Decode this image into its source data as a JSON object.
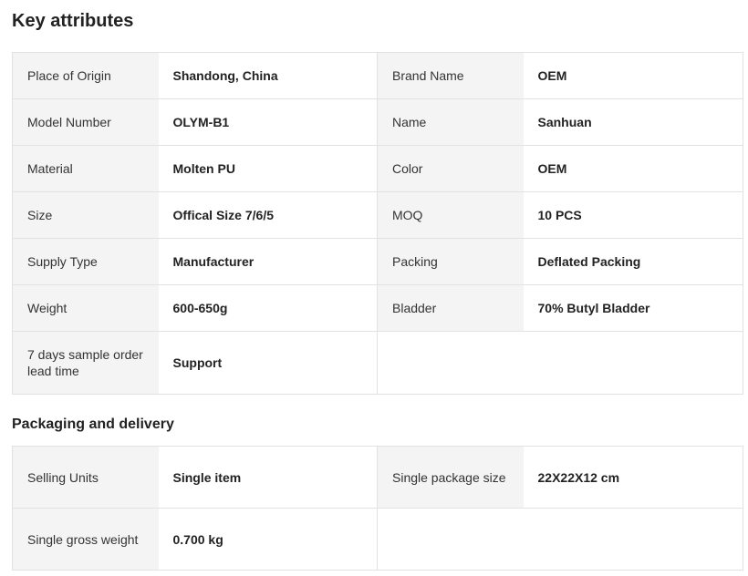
{
  "key_attributes": {
    "title": "Key attributes",
    "rows": [
      {
        "k1": "Place of Origin",
        "v1": "Shandong, China",
        "k2": "Brand Name",
        "v2": "OEM"
      },
      {
        "k1": "Model Number",
        "v1": "OLYM-B1",
        "k2": "Name",
        "v2": "Sanhuan"
      },
      {
        "k1": "Material",
        "v1": "Molten PU",
        "k2": "Color",
        "v2": "OEM"
      },
      {
        "k1": "Size",
        "v1": "Offical Size 7/6/5",
        "k2": "MOQ",
        "v2": "10 PCS"
      },
      {
        "k1": "Supply Type",
        "v1": "Manufacturer",
        "k2": "Packing",
        "v2": "Deflated Packing"
      },
      {
        "k1": "Weight",
        "v1": "600-650g",
        "k2": "Bladder",
        "v2": "70% Butyl Bladder"
      },
      {
        "k1": "7 days sample order lead time",
        "v1": "Support"
      }
    ]
  },
  "packaging": {
    "title": "Packaging and delivery",
    "rows": [
      {
        "k1": "Selling Units",
        "v1": "Single item",
        "k2": "Single package size",
        "v2": "22X22X12 cm"
      },
      {
        "k1": "Single gross weight",
        "v1": "0.700 kg"
      }
    ]
  }
}
